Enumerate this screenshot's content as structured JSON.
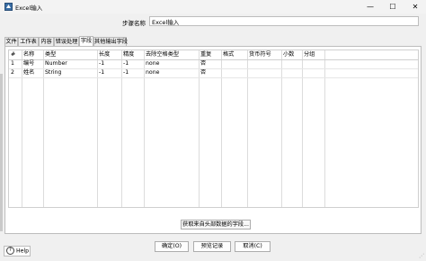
{
  "window": {
    "title": "Excel输入",
    "minimize_glyph": "—",
    "maximize_glyph": "☐",
    "close_glyph": "✕",
    "icon": "spoon-app-icon"
  },
  "step": {
    "label": "步骤名称",
    "value": "Excel输入"
  },
  "tabs": [
    {
      "label": "文件"
    },
    {
      "label": "工作表"
    },
    {
      "label": "内容"
    },
    {
      "label": "错误处理"
    },
    {
      "label": "字段"
    },
    {
      "label": "其他输出字段"
    }
  ],
  "active_tab": "字段",
  "table": {
    "columns": [
      "#",
      "名称",
      "类型",
      "长度",
      "精度",
      "去除空格类型",
      "重复",
      "格式",
      "货币符号",
      "小数",
      "分组"
    ],
    "rows": [
      [
        "1",
        "编号",
        "Number",
        "-1",
        "-1",
        "none",
        "否",
        "",
        "",
        "",
        ""
      ],
      [
        "2",
        "姓名",
        "String",
        "-1",
        "-1",
        "none",
        "否",
        "",
        "",
        "",
        ""
      ]
    ]
  },
  "buttons": {
    "get_fields": "获取来自头部数据的字段...",
    "ok": "确定(O)",
    "preview": "预览记录",
    "cancel": "取消(C)",
    "help": "Help"
  },
  "icons": {
    "help": "help-icon"
  }
}
